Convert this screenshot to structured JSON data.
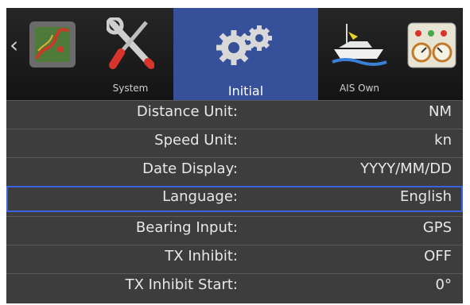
{
  "tabs": [
    {
      "label": "",
      "icon": "radar-chart-icon"
    },
    {
      "label": "System",
      "icon": "wrench-screwdriver-icon"
    },
    {
      "label": "Initial",
      "icon": "gears-icon"
    },
    {
      "label": "AIS Own",
      "icon": "ship-icon"
    },
    {
      "label": "",
      "icon": "gauges-icon"
    }
  ],
  "nav": {
    "left_arrow": "‹"
  },
  "settings": [
    {
      "label": "Distance Unit:",
      "value": "NM"
    },
    {
      "label": "Speed Unit:",
      "value": "kn"
    },
    {
      "label": "Date Display:",
      "value": "YYYY/MM/DD"
    },
    {
      "label": "Language:",
      "value": "English"
    },
    {
      "label": "Bearing Input:",
      "value": "GPS"
    },
    {
      "label": "TX Inhibit:",
      "value": "OFF"
    },
    {
      "label": "TX Inhibit Start:",
      "value": "0°"
    }
  ],
  "colors": {
    "selected_tab": "#36519a",
    "selected_row_border": "#3a63e0",
    "list_bg": "#3d3d3d"
  }
}
